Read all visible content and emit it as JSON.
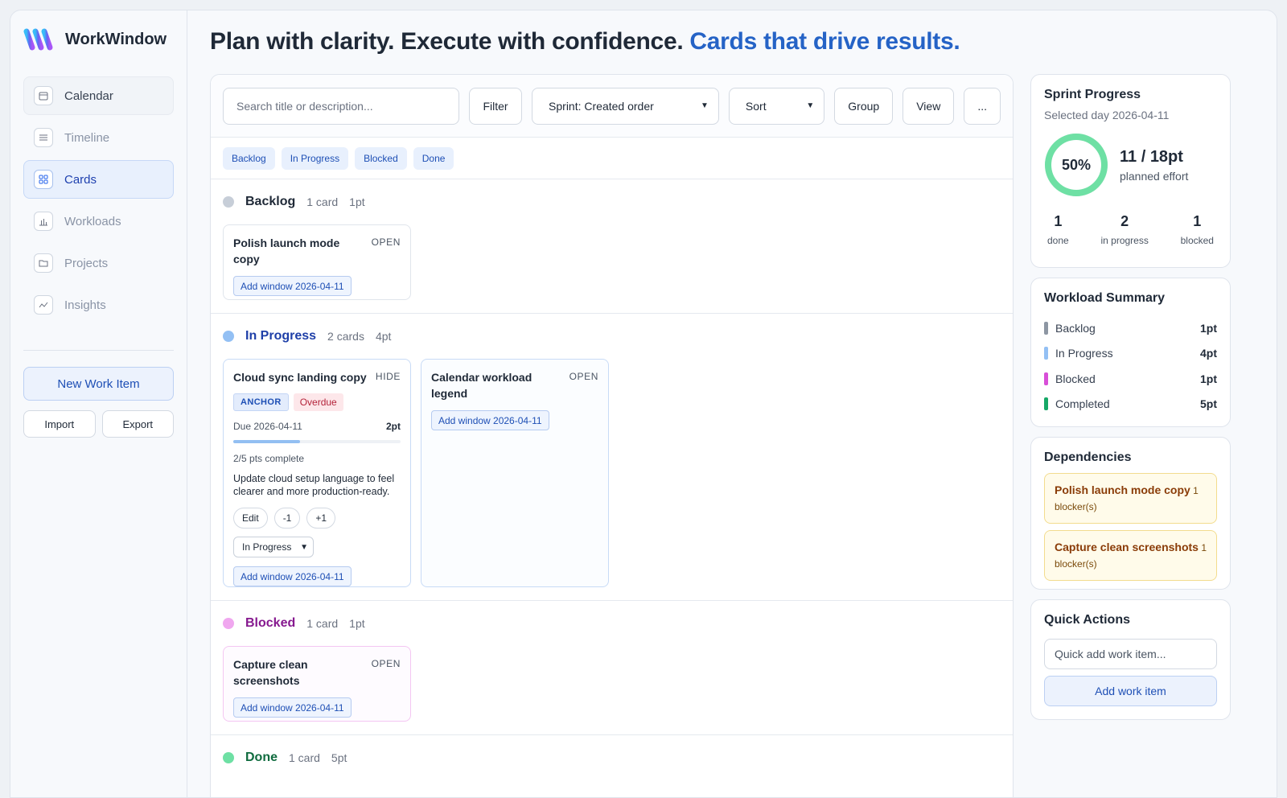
{
  "app": {
    "name": "WorkWindow"
  },
  "nav": [
    {
      "label": "Calendar",
      "icon": "calendar-icon"
    },
    {
      "label": "Timeline",
      "icon": "timeline-icon"
    },
    {
      "label": "Cards",
      "icon": "cards-icon"
    },
    {
      "label": "Workloads",
      "icon": "bar-chart-icon"
    },
    {
      "label": "Projects",
      "icon": "folder-icon"
    },
    {
      "label": "Insights",
      "icon": "line-chart-icon"
    }
  ],
  "sidebar_actions": {
    "new_item": "New Work Item",
    "import": "Import",
    "export": "Export"
  },
  "headline": {
    "main": "Plan with clarity. Execute with confidence.",
    "accent": "Cards that drive results."
  },
  "toolbar": {
    "search_placeholder": "Search title or description...",
    "filter": "Filter",
    "sprint_select": "Sprint: Created order",
    "sort_select": "Sort",
    "group": "Group",
    "view": "View",
    "more": "..."
  },
  "chips": [
    "Backlog",
    "In Progress",
    "Blocked",
    "Done"
  ],
  "sections": {
    "backlog": {
      "title": "Backlog",
      "count": "1 card",
      "points": "1pt",
      "color": "#c7ced8"
    },
    "in_progress": {
      "title": "In Progress",
      "count": "2 cards",
      "points": "4pt",
      "color": "#93c0f4"
    },
    "blocked": {
      "title": "Blocked",
      "count": "1 card",
      "points": "1pt",
      "color": "#f0a7ef"
    },
    "done": {
      "title": "Done",
      "count": "1 card",
      "points": "5pt",
      "color": "#6ee0a4"
    }
  },
  "cards": {
    "polish": {
      "title": "Polish launch mode copy",
      "state": "OPEN",
      "window": "Add window 2026-04-11"
    },
    "cloud": {
      "title": "Cloud sync landing copy",
      "state": "HIDE",
      "badge_anchor": "ANCHOR",
      "badge_overdue": "Overdue",
      "due": "Due 2026-04-11",
      "points": "2pt",
      "progress": 0.4,
      "progress_label": "2/5 pts complete",
      "description": "Update cloud setup language to feel clearer and more production-ready.",
      "actions": [
        "Edit",
        "-1",
        "+1"
      ],
      "status": "In Progress",
      "window": "Add window 2026-04-11"
    },
    "calendar": {
      "title": "Calendar workload legend",
      "state": "OPEN",
      "window": "Add window 2026-04-11"
    },
    "capture": {
      "title": "Capture clean screenshots",
      "state": "OPEN",
      "window": "Add window 2026-04-11"
    }
  },
  "sprint": {
    "title": "Sprint Progress",
    "selected_day": "Selected day 2026-04-11",
    "percent_label": "50%",
    "percent": 0.5,
    "effort": "11 / 18pt",
    "effort_label": "planned effort",
    "stats": [
      {
        "value": "1",
        "label": "done"
      },
      {
        "value": "2",
        "label": "in progress"
      },
      {
        "value": "1",
        "label": "blocked"
      }
    ]
  },
  "workload": {
    "title": "Workload Summary",
    "rows": [
      {
        "label": "Backlog",
        "value": "1pt",
        "color": "#8d96a3"
      },
      {
        "label": "In Progress",
        "value": "4pt",
        "color": "#93c0f4"
      },
      {
        "label": "Blocked",
        "value": "1pt",
        "color": "#d84fd8"
      },
      {
        "label": "Completed",
        "value": "5pt",
        "color": "#16a867"
      }
    ]
  },
  "dependencies": {
    "title": "Dependencies",
    "items": [
      {
        "title": "Polish launch mode copy",
        "blockers": "1 blocker(s)"
      },
      {
        "title": "Capture clean screenshots",
        "blockers": "1 blocker(s)"
      }
    ]
  },
  "quick_actions": {
    "title": "Quick Actions",
    "placeholder": "Quick add work item...",
    "button": "Add work item"
  },
  "colors": {
    "accent": "#2563c6",
    "brand_gradient": [
      "#38bdf8",
      "#6366f1",
      "#a855f7"
    ]
  }
}
